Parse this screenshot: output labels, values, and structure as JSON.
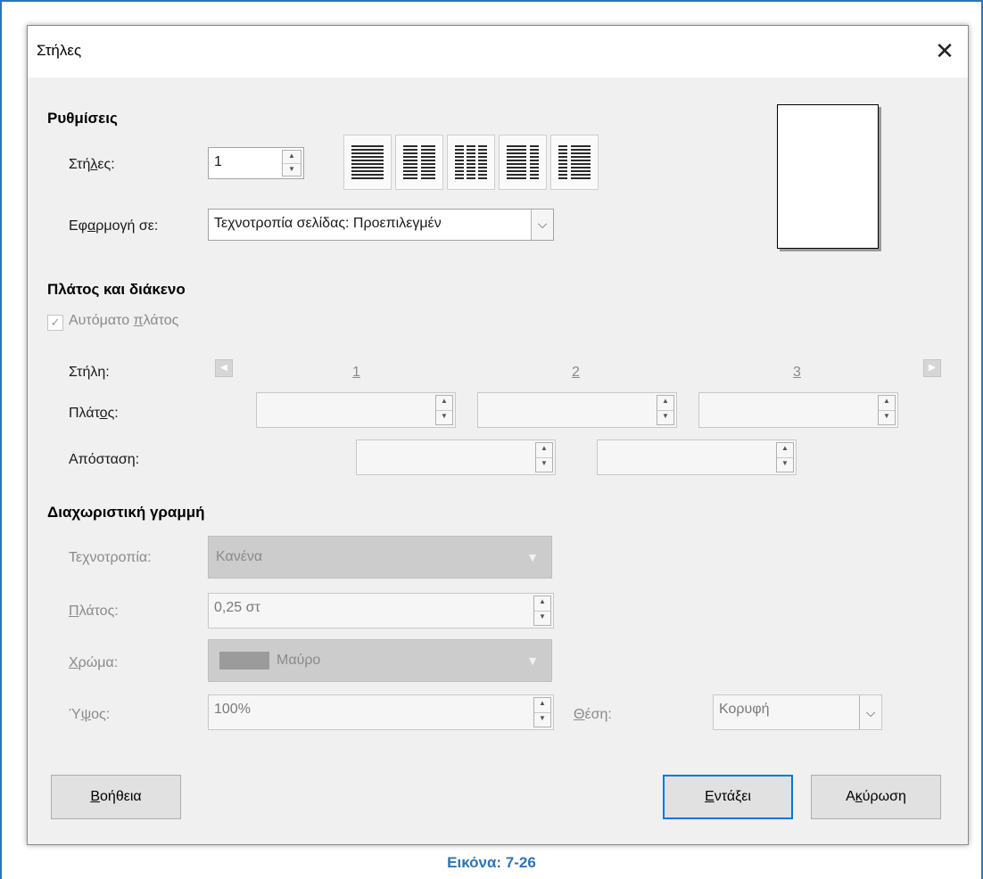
{
  "window": {
    "title": "Στήλες",
    "close_glyph": "✕"
  },
  "settings": {
    "heading": "Ρυθμίσεις",
    "columns_label": "Στήλες:",
    "columns_value": "1",
    "apply_label": "Εφαρμογή σε:",
    "apply_value": "Τεχνοτροπία σελίδας: Προεπιλεγμέν",
    "layouts": [
      "one-column",
      "two-columns",
      "three-columns",
      "two-columns-left-wide",
      "two-columns-right-wide"
    ]
  },
  "width_spacing": {
    "heading": "Πλάτος και διάκενο",
    "auto_width_label": "Αυτόματο πλάτος",
    "auto_width_checked": true,
    "column_label": "Στήλη:",
    "column_numbers": [
      "1",
      "2",
      "3"
    ],
    "width_label": "Πλάτος:",
    "spacing_label": "Απόσταση:",
    "width_values": [
      "",
      "",
      ""
    ],
    "spacing_values": [
      "",
      ""
    ]
  },
  "separator": {
    "heading": "Διαχωριστική γραμμή",
    "style_label": "Τεχνοτροπία:",
    "style_value": "Κανένα",
    "width_label": "Πλάτος:",
    "width_value": "0,25 στ",
    "color_label": "Χρώμα:",
    "color_value": "Μαύρο",
    "color_swatch": "#9b9b9b",
    "height_label": "Ύψος:",
    "height_value": "100%",
    "position_label": "Θέση:",
    "position_value": "Κορυφή"
  },
  "buttons": {
    "help": "Βοήθεια",
    "ok": "Εντάξει",
    "cancel": "Ακύρωση"
  },
  "caption": "Εικόνα: 7-26",
  "colors": {
    "frame": "#2e74b5",
    "dialog_bg": "#f0f0f0",
    "default_button_border": "#0078d7"
  }
}
